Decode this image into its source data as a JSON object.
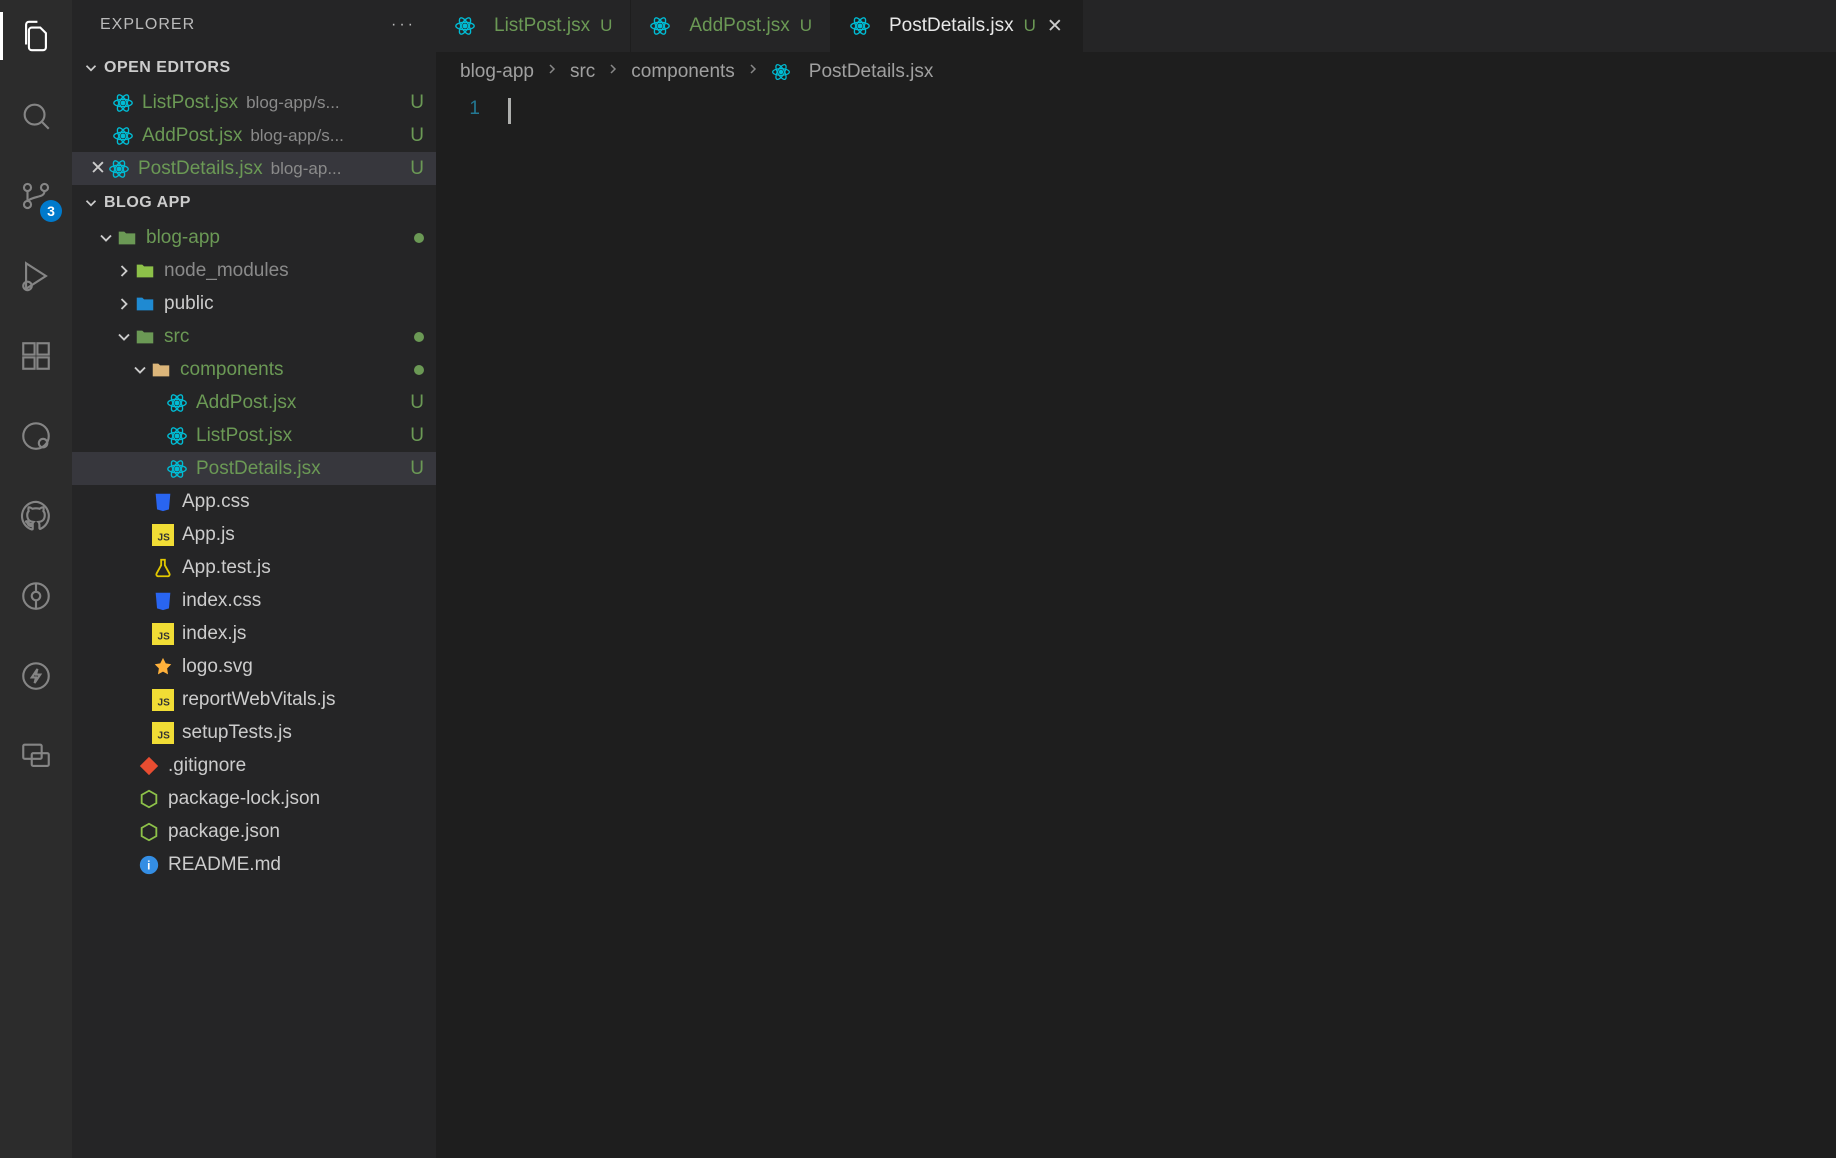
{
  "activityBar": {
    "scmBadge": "3"
  },
  "sidebar": {
    "title": "EXPLORER",
    "openEditors": {
      "label": "OPEN EDITORS",
      "items": [
        {
          "name": "ListPost.jsx",
          "path": "blog-app/s...",
          "status": "U"
        },
        {
          "name": "AddPost.jsx",
          "path": "blog-app/s...",
          "status": "U"
        },
        {
          "name": "PostDetails.jsx",
          "path": "blog-ap...",
          "status": "U"
        }
      ]
    },
    "workspace": {
      "label": "BLOG APP",
      "tree": {
        "root": {
          "name": "blog-app"
        },
        "nodeModules": "node_modules",
        "public": "public",
        "src": "src",
        "components": "components",
        "compFiles": [
          {
            "name": "AddPost.jsx",
            "status": "U"
          },
          {
            "name": "ListPost.jsx",
            "status": "U"
          },
          {
            "name": "PostDetails.jsx",
            "status": "U"
          }
        ],
        "srcFiles": [
          "App.css",
          "App.js",
          "App.test.js",
          "index.css",
          "index.js",
          "logo.svg",
          "reportWebVitals.js",
          "setupTests.js"
        ],
        "rootFiles": [
          ".gitignore",
          "package-lock.json",
          "package.json",
          "README.md"
        ]
      }
    }
  },
  "tabs": [
    {
      "name": "ListPost.jsx",
      "status": "U"
    },
    {
      "name": "AddPost.jsx",
      "status": "U"
    },
    {
      "name": "PostDetails.jsx",
      "status": "U"
    }
  ],
  "breadcrumb": {
    "parts": [
      "blog-app",
      "src",
      "components",
      "PostDetails.jsx"
    ]
  },
  "editor": {
    "lineNumber": "1"
  },
  "colors": {
    "gitModified": "#6b9955",
    "reactIcon": "#00bcd4"
  }
}
